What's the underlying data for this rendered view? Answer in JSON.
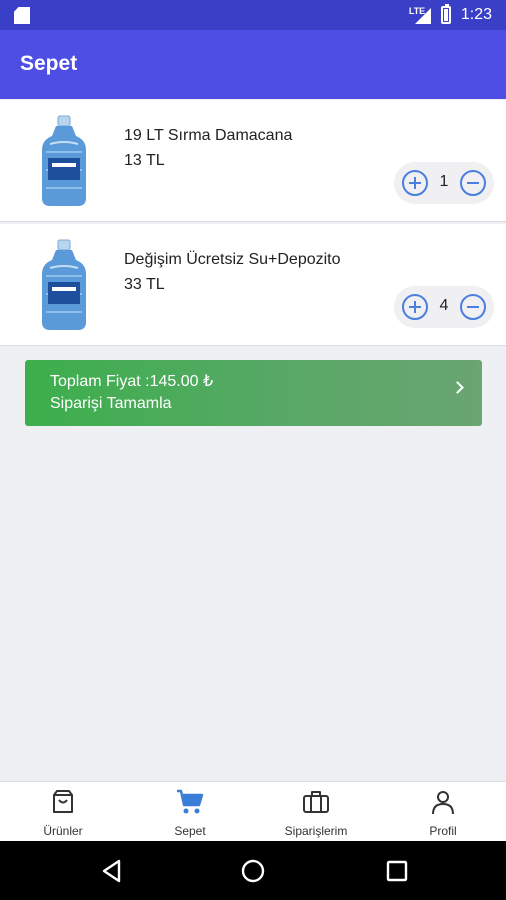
{
  "status_bar": {
    "network": "LTE",
    "time": "1:23"
  },
  "app_bar": {
    "title": "Sepet"
  },
  "cart": {
    "items": [
      {
        "name": "19 LT Sırma Damacana",
        "price": "13 TL",
        "quantity": "1"
      },
      {
        "name": "Değişim Ücretsiz Su+Depozito",
        "price": "33 TL",
        "quantity": "4"
      }
    ]
  },
  "checkout": {
    "total": "Toplam Fiyat :145.00 ₺",
    "action": "Siparişi Tamamla"
  },
  "bottom_nav": {
    "items": [
      {
        "label": "Ürünler",
        "icon": "shopping-bag-icon"
      },
      {
        "label": "Sepet",
        "icon": "cart-icon"
      },
      {
        "label": "Siparişlerim",
        "icon": "briefcase-icon"
      },
      {
        "label": "Profil",
        "icon": "person-icon"
      }
    ],
    "active_index": 1
  },
  "colors": {
    "primary": "#4f4ee4",
    "status_bar": "#3a3fc8",
    "checkout_green": "#3caf4c",
    "accent_blue": "#4a7fe0",
    "active_icon": "#3b7ed8"
  }
}
